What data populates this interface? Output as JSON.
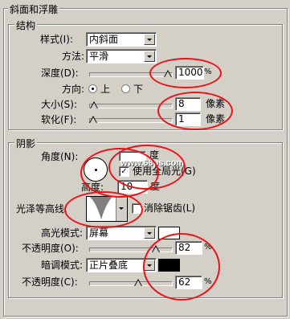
{
  "bevel": {
    "group_title": "斜面和浮雕",
    "structure_title": "结构",
    "style_label": "样式(I):",
    "style_value": "内斜面",
    "method_label": "方法:",
    "method_value": "平滑",
    "depth_label": "深度(D):",
    "depth_value": "1000",
    "depth_unit": "%",
    "direction_label": "方向:",
    "direction_up": "上",
    "direction_down": "下",
    "size_label": "大小(S):",
    "size_value": "8",
    "size_unit": "像素",
    "soften_label": "软化(F):",
    "soften_value": "1",
    "soften_unit": "像素"
  },
  "shading": {
    "group_title": "阴影",
    "angle_label": "角度(N):",
    "angle_value": "度",
    "global_light_label": "使用全局光(G)",
    "global_light_checked": true,
    "altitude_label": "高度:",
    "altitude_value": "10",
    "altitude_unit": "度",
    "gloss_contour_label": "光泽等高线:",
    "antialias_label": "消除锯齿(L)",
    "highlight_mode_label": "高光模式:",
    "highlight_mode_value": "屏幕",
    "highlight_color": "#ffffff",
    "highlight_opacity_label": "不透明度(O):",
    "highlight_opacity_value": "82",
    "highlight_opacity_unit": "%",
    "shadow_mode_label": "暗调模式:",
    "shadow_mode_value": "正片叠底",
    "shadow_color": "#000000",
    "shadow_opacity_label": "不透明度(C):",
    "shadow_opacity_value": "62",
    "shadow_opacity_unit": "%"
  },
  "watermark": "www.68ps.com"
}
